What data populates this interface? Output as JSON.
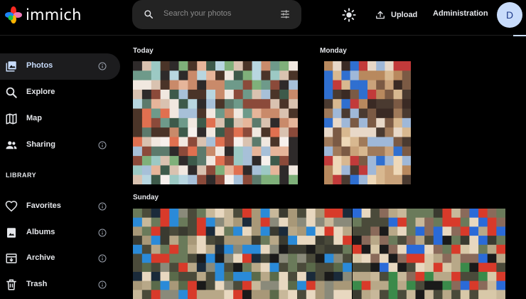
{
  "app": {
    "name": "immich"
  },
  "header": {
    "search_placeholder": "Search your photos",
    "upload_label": "Upload",
    "admin_label": "Administration",
    "avatar_initial": "D"
  },
  "sidebar": {
    "items": [
      {
        "label": "Photos",
        "icon": "photos-icon",
        "active": true,
        "info": true
      },
      {
        "label": "Explore",
        "icon": "explore-icon",
        "info": false
      },
      {
        "label": "Map",
        "icon": "map-icon",
        "info": false
      },
      {
        "label": "Sharing",
        "icon": "sharing-icon",
        "info": true
      }
    ],
    "library_label": "LIBRARY",
    "library_items": [
      {
        "label": "Favorites",
        "icon": "heart-icon",
        "info": true
      },
      {
        "label": "Albums",
        "icon": "albums-icon",
        "info": true
      },
      {
        "label": "Archive",
        "icon": "archive-icon",
        "info": true
      },
      {
        "label": "Trash",
        "icon": "trash-icon",
        "info": true
      }
    ]
  },
  "timeline": {
    "groups": [
      {
        "title": "Today"
      },
      {
        "title": "Monday"
      },
      {
        "title": "Sunday"
      }
    ]
  },
  "colors": {
    "accent": "#c8dcfb",
    "background": "#000000",
    "search_bg": "#232323",
    "active_bg": "#1c1c1e"
  }
}
